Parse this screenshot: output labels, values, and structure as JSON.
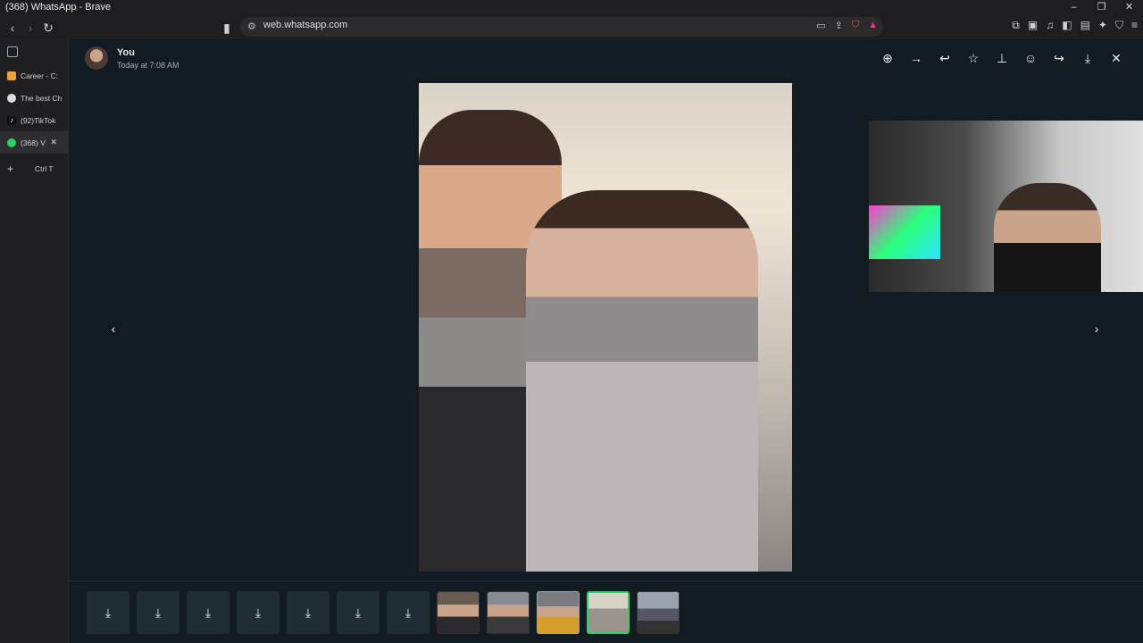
{
  "window": {
    "title": "(368) WhatsApp - Brave"
  },
  "toolbar": {
    "url": "web.whatsapp.com"
  },
  "sidebar": {
    "tabs": [
      {
        "label": "Career - C:",
        "color": "#e8a33b"
      },
      {
        "label": "The best Ch",
        "color": "#dcdcdc"
      },
      {
        "label": "(92)TikTok",
        "color": "#111111"
      },
      {
        "label": "(368) V",
        "color": "#25d366"
      }
    ],
    "new_tab_shortcut": "Ctrl T"
  },
  "viewer": {
    "sender_name": "You",
    "sender_time": "Today at 7:08 AM",
    "actions": [
      "zoom-in",
      "forward",
      "reply",
      "star",
      "pin",
      "react",
      "share",
      "download",
      "close"
    ]
  },
  "thumbnails": {
    "download_placeholders": 7,
    "images": [
      "thumb-1",
      "thumb-2",
      "thumb-3",
      "thumb-4",
      "thumb-5"
    ],
    "selected_index": 3
  },
  "colors": {
    "accent": "#25d366",
    "viewer_bg": "#111b21"
  }
}
